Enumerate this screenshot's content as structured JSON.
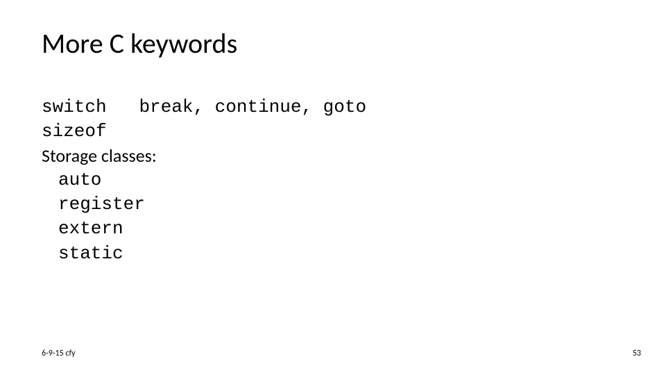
{
  "title": "More C keywords",
  "body": {
    "line1_kw": "switch",
    "line1_rest": "break, continue, goto",
    "line2": "sizeof",
    "storage_label": "Storage classes:",
    "sc1": "auto",
    "sc2": "register",
    "sc3": "extern",
    "sc4": "static"
  },
  "footer": {
    "left": "6-9-15 cfy",
    "right": "53"
  }
}
